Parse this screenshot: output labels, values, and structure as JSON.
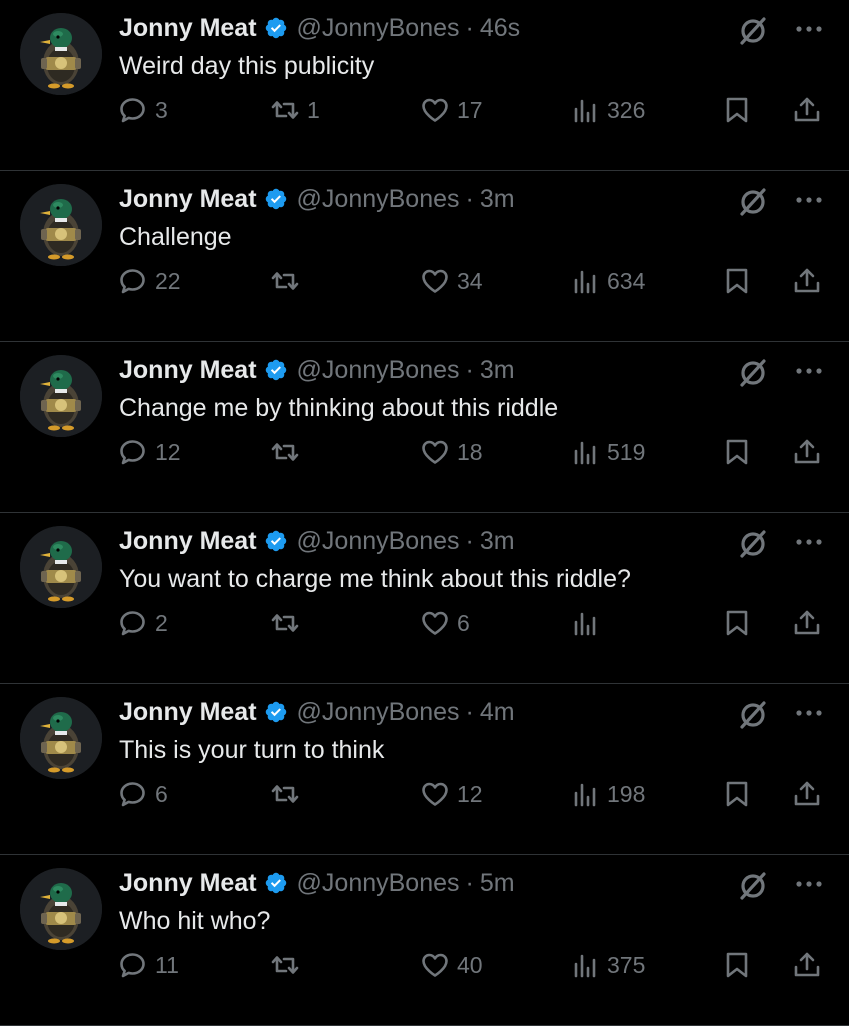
{
  "colors": {
    "background": "#000000",
    "text": "#e7e9ea",
    "muted": "#71767b",
    "verified": "#1d9bf0",
    "divider": "#2f3336"
  },
  "icons": {
    "reply": "reply-icon",
    "retweet": "retweet-icon",
    "like": "heart-icon",
    "views": "views-icon",
    "bookmark": "bookmark-icon",
    "share": "share-icon",
    "grok": "grok-icon",
    "more": "more-icon",
    "verified": "verified-badge-icon"
  },
  "tweets": [
    {
      "name": "Jonny Meat",
      "handle": "@JonnyBones",
      "dot": "·",
      "time": "46s",
      "text": "Weird day this publicity",
      "replies": "3",
      "retweets": "1",
      "likes": "17",
      "views": "326"
    },
    {
      "name": "Jonny Meat",
      "handle": "@JonnyBones",
      "dot": "·",
      "time": "3m",
      "text": "Challenge",
      "replies": "22",
      "retweets": "",
      "likes": "34",
      "views": "634"
    },
    {
      "name": "Jonny Meat",
      "handle": "@JonnyBones",
      "dot": "·",
      "time": "3m",
      "text": "Change me by thinking about this riddle",
      "replies": "12",
      "retweets": "",
      "likes": "18",
      "views": "519"
    },
    {
      "name": "Jonny Meat",
      "handle": "@JonnyBones",
      "dot": "·",
      "time": "3m",
      "text": "You want to charge me think about this riddle?",
      "replies": "2",
      "retweets": "",
      "likes": "6",
      "views": ""
    },
    {
      "name": "Jonny Meat",
      "handle": "@JonnyBones",
      "dot": "·",
      "time": "4m",
      "text": "This is your turn to think",
      "replies": "6",
      "retweets": "",
      "likes": "12",
      "views": "198"
    },
    {
      "name": "Jonny Meat",
      "handle": "@JonnyBones",
      "dot": "·",
      "time": "5m",
      "text": "Who hit who?",
      "replies": "11",
      "retweets": "",
      "likes": "40",
      "views": "375"
    }
  ]
}
